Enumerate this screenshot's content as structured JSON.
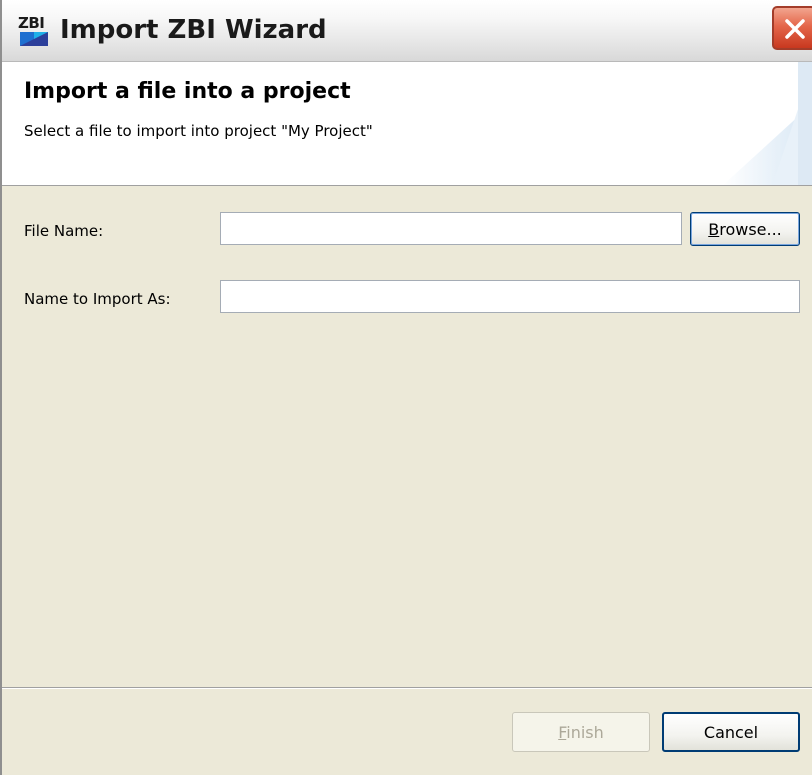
{
  "window": {
    "title": "Import ZBI Wizard",
    "icon_abbr": "ZBI",
    "icon": "zbi-app-icon",
    "close_icon": "close-x-icon"
  },
  "header": {
    "title": "Import a file into a project",
    "description": "Select a file to import into project \"My Project\""
  },
  "form": {
    "file_name_label": "File Name:",
    "file_name_value": "",
    "browse_label_mnemonic": "B",
    "browse_label_rest": "rowse...",
    "import_as_label": "Name to Import As:",
    "import_as_value": ""
  },
  "footer": {
    "finish_mnemonic": "F",
    "finish_rest": "inish",
    "finish_enabled": false,
    "cancel_label": "Cancel"
  },
  "colors": {
    "window_bg": "#ece9d8",
    "header_bg": "#ffffff",
    "close_button": "#e4664a",
    "button_border": "#003c74"
  }
}
